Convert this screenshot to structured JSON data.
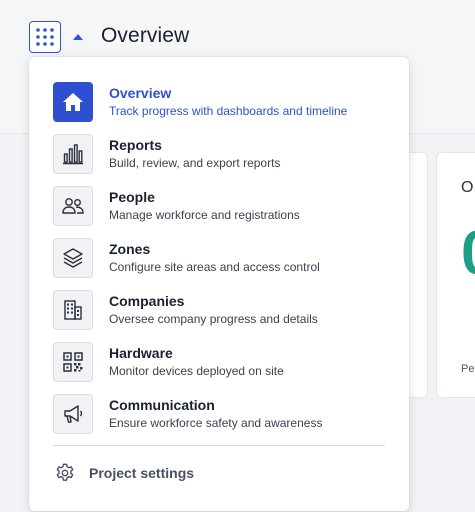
{
  "header": {
    "title": "Overview",
    "apps_icon": "grid-dots-icon",
    "caret_icon": "caret-up-icon"
  },
  "background": {
    "card_label": "O",
    "card_value": "0",
    "card_footer": "Pe"
  },
  "menu": {
    "items": [
      {
        "title": "Overview",
        "description": "Track progress with dashboards and timeline",
        "icon": "home-icon",
        "active": true
      },
      {
        "title": "Reports",
        "description": "Build, review, and export reports",
        "icon": "bar-chart-icon",
        "active": false
      },
      {
        "title": "People",
        "description": "Manage workforce and registrations",
        "icon": "people-icon",
        "active": false
      },
      {
        "title": "Zones",
        "description": "Configure site areas and access control",
        "icon": "layers-icon",
        "active": false
      },
      {
        "title": "Companies",
        "description": "Oversee company progress and details",
        "icon": "building-icon",
        "active": false
      },
      {
        "title": "Hardware",
        "description": "Monitor devices deployed on site",
        "icon": "qr-code-icon",
        "active": false
      },
      {
        "title": "Communication",
        "description": "Ensure workforce safety and awareness",
        "icon": "megaphone-icon",
        "active": false
      }
    ],
    "settings_label": "Project settings",
    "settings_icon": "gear-icon"
  },
  "colors": {
    "accent": "#2f4fd0",
    "card_value": "#1e9e86"
  }
}
